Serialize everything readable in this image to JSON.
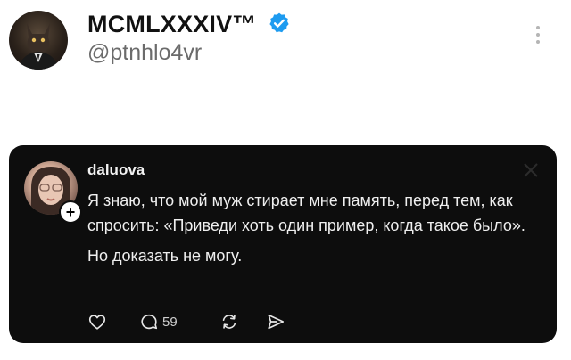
{
  "profile": {
    "display_name": "MCMLXXXIV™",
    "handle": "@ptnhlo4vr",
    "verified_color": "#1d9bf0"
  },
  "post": {
    "username": "daluova",
    "paragraphs": [
      "Я знаю, что мой муж стирает мне память, перед тем, как спросить: «Приведи хоть один пример, когда такое было».",
      "Но доказать не могу."
    ],
    "actions": {
      "like_icon": "heart-icon",
      "reply_icon": "comment-icon",
      "reply_count": "59",
      "repost_icon": "repost-icon",
      "share_icon": "send-icon"
    }
  }
}
